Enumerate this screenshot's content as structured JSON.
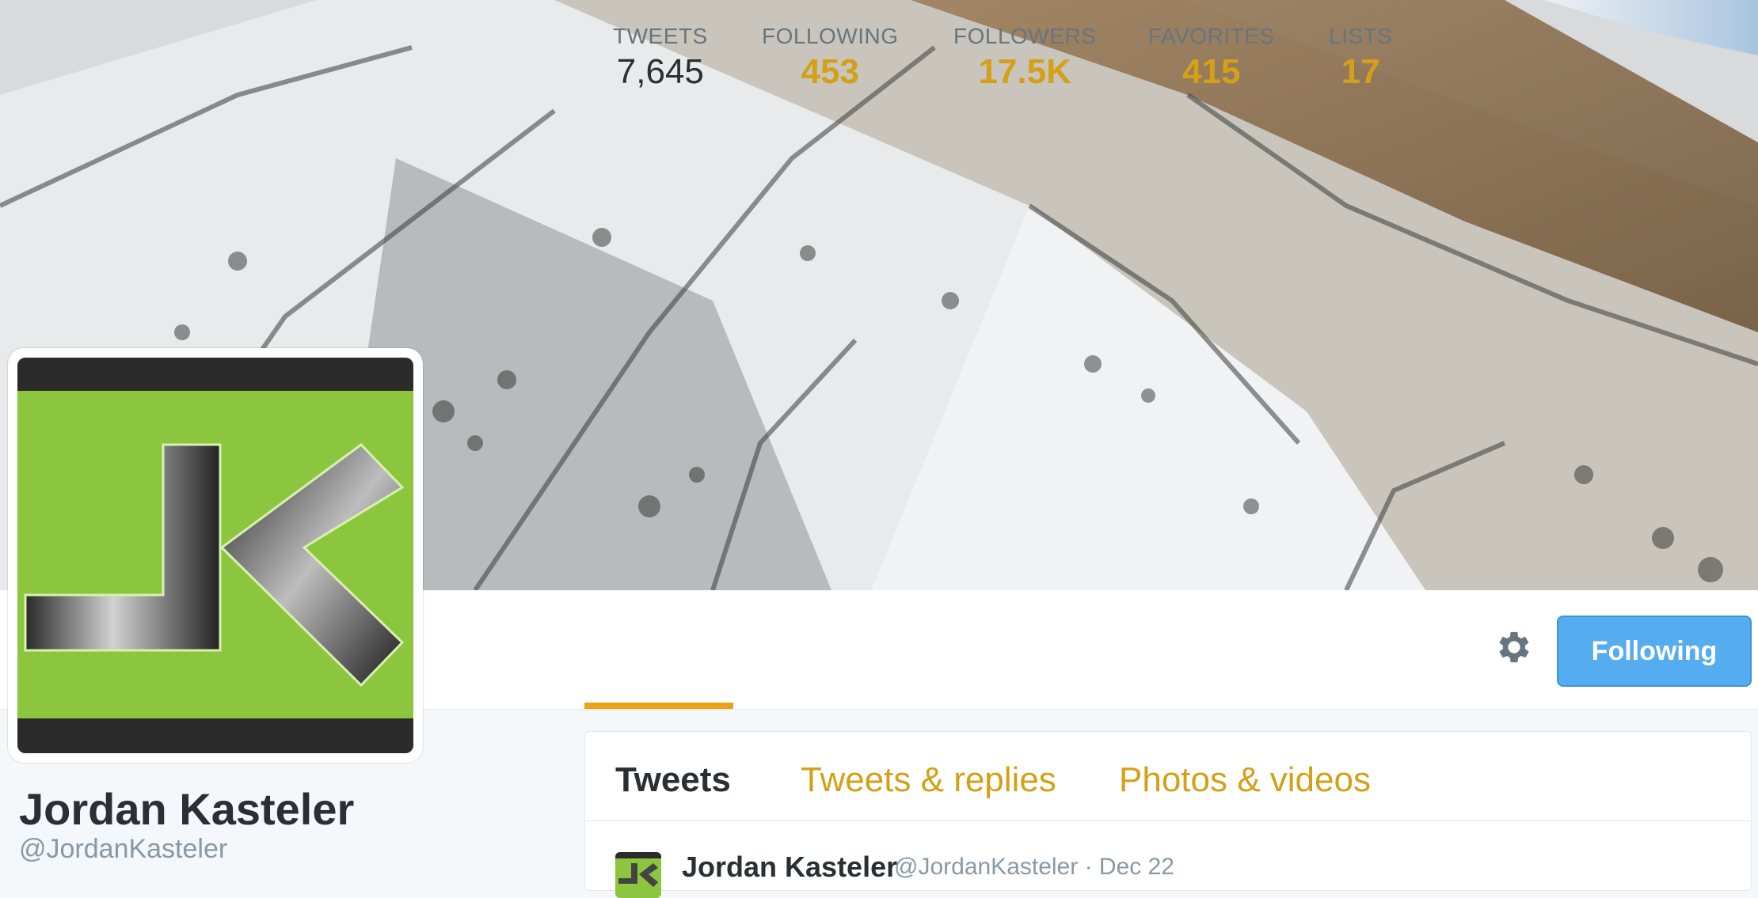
{
  "profile": {
    "name": "Jordan Kasteler",
    "handle": "@JordanKasteler"
  },
  "stats": [
    {
      "label": "TWEETS",
      "value": "7,645",
      "active": true
    },
    {
      "label": "FOLLOWING",
      "value": "453"
    },
    {
      "label": "FOLLOWERS",
      "value": "17.5K"
    },
    {
      "label": "FAVORITES",
      "value": "415"
    },
    {
      "label": "LISTS",
      "value": "17"
    }
  ],
  "actions": {
    "follow_label": "Following",
    "settings_icon": "gear-icon"
  },
  "timeline": {
    "tabs": [
      {
        "label": "Tweets",
        "active": true
      },
      {
        "label": "Tweets & replies"
      },
      {
        "label": "Photos & videos"
      }
    ],
    "first_tweet": {
      "author": "Jordan Kasteler",
      "meta": "@JordanKasteler · Dec 22"
    }
  },
  "colors": {
    "accent": "#d4a017",
    "underline": "#e8a317",
    "button": "#55acee",
    "avatar_green": "#8cc63f"
  }
}
